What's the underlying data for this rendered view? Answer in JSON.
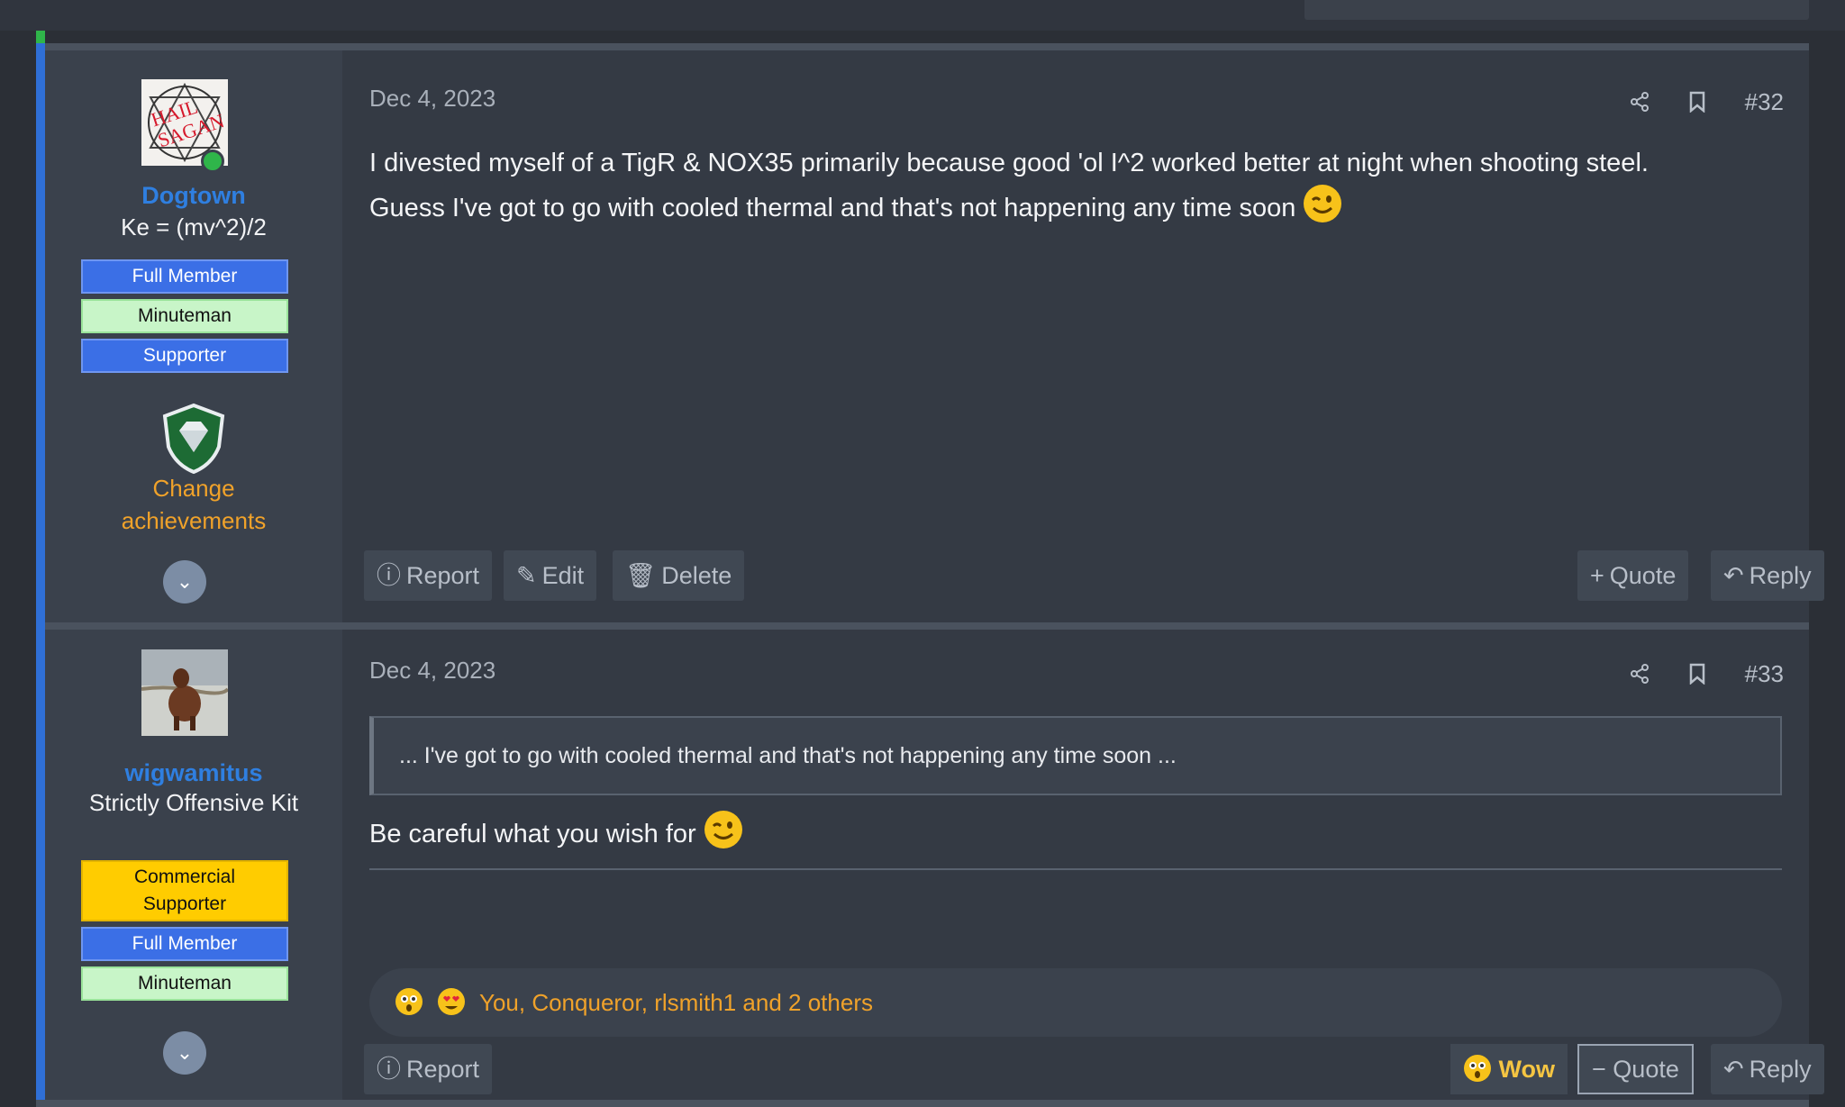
{
  "posts": [
    {
      "username": "Dogtown",
      "user_title": "Ke = (mv^2)/2",
      "banners": [
        "Full Member",
        "Minuteman",
        "Supporter"
      ],
      "achievement_label_1": "Change",
      "achievement_label_2": "achievements",
      "date": "Dec 4, 2023",
      "number": "#32",
      "body_line1": "I divested myself of a TigR & NOX35 primarily because good 'ol I^2 worked better at night when shooting steel.",
      "body_line2": "Guess I've got to go with cooled thermal and that's not happening any time soon",
      "actions": {
        "report": "Report",
        "edit": "Edit",
        "delete": "Delete",
        "quote": "Quote",
        "reply": "Reply"
      }
    },
    {
      "username": "wigwamitus",
      "user_title": "Strictly Offensive Kit",
      "banners": [
        "Commercial Supporter",
        "Full Member",
        "Minuteman"
      ],
      "date": "Dec 4, 2023",
      "number": "#33",
      "quote": "... I've got to go with cooled thermal and that's not happening any time soon ...",
      "body": "Be careful what you wish for",
      "reactions_text": "You, Conqueror, rlsmith1 and 2 others",
      "actions": {
        "report": "Report",
        "wow": "Wow",
        "quote": "Quote",
        "reply": "Reply"
      }
    }
  ],
  "icons": [
    "share-icon",
    "bookmark-icon",
    "report-icon",
    "edit-icon",
    "delete-icon",
    "plus-icon",
    "minus-icon",
    "reply-icon",
    "chevron-down-icon",
    "wink-emoji",
    "wow-emoji",
    "love-emoji"
  ],
  "colors": {
    "accent": "#2f6fd6",
    "username": "#2f7fe0",
    "achievement": "#f0a22a",
    "full_member": "#3b6fe6",
    "minuteman": "#c8f5c8",
    "commercial": "#ffcc00",
    "wow": "#f5c542"
  }
}
